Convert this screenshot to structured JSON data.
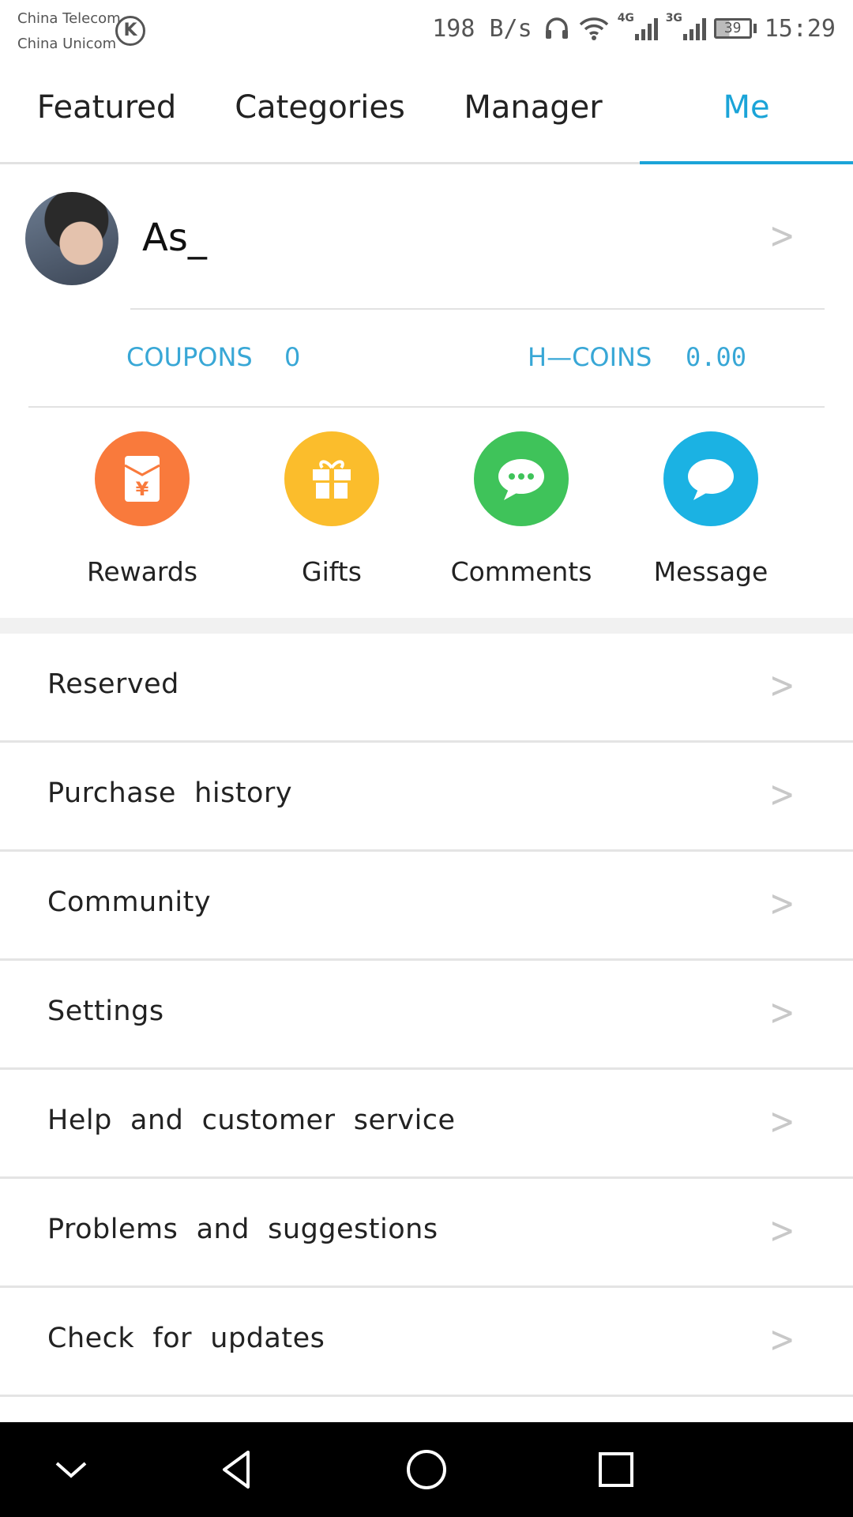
{
  "status_bar": {
    "carrier_1": "China Telecom",
    "carrier_2": "China Unicom",
    "carrier_badge": "K",
    "net_speed": "198 B/s",
    "network_1": "4G",
    "network_2": "3G",
    "battery_level": "39",
    "time": "15:29",
    "icons": [
      "headset-icon",
      "wifi-icon",
      "signal-icon",
      "battery-icon"
    ]
  },
  "tabs": [
    {
      "label": "Featured",
      "active": false
    },
    {
      "label": "Categories",
      "active": false
    },
    {
      "label": "Manager",
      "active": false
    },
    {
      "label": "Me",
      "active": true
    }
  ],
  "profile": {
    "username": "As_",
    "chevron": ">"
  },
  "stats": {
    "coupons_label": "COUPONS",
    "coupons_value": "0",
    "hcoins_label": "H—COINS",
    "hcoins_value": "0.00"
  },
  "shortcuts": [
    {
      "label": "Rewards",
      "icon": "red-envelope-icon",
      "color": "#f97a3c"
    },
    {
      "label": "Gifts",
      "icon": "gift-icon",
      "color": "#fbbd2c"
    },
    {
      "label": "Comments",
      "icon": "comment-bubble-icon",
      "color": "#3fc35a"
    },
    {
      "label": "Message",
      "icon": "message-bubble-icon",
      "color": "#1bb2e3"
    }
  ],
  "menu": [
    {
      "label": "Reserved",
      "chevron": ">"
    },
    {
      "label": "Purchase  history",
      "chevron": ">"
    },
    {
      "label": "Community",
      "chevron": ">"
    },
    {
      "label": "Settings",
      "chevron": ">"
    },
    {
      "label": "Help  and  customer  service",
      "chevron": ">"
    },
    {
      "label": "Problems  and  suggestions",
      "chevron": ">"
    },
    {
      "label": "Check  for  updates",
      "chevron": ">"
    }
  ],
  "navbar": {
    "icons": [
      "down-chevron-icon",
      "back-triangle-icon",
      "home-circle-icon",
      "recents-square-icon"
    ]
  },
  "colors": {
    "accent": "#1ba4d8",
    "stats_text": "#38a7d6"
  }
}
